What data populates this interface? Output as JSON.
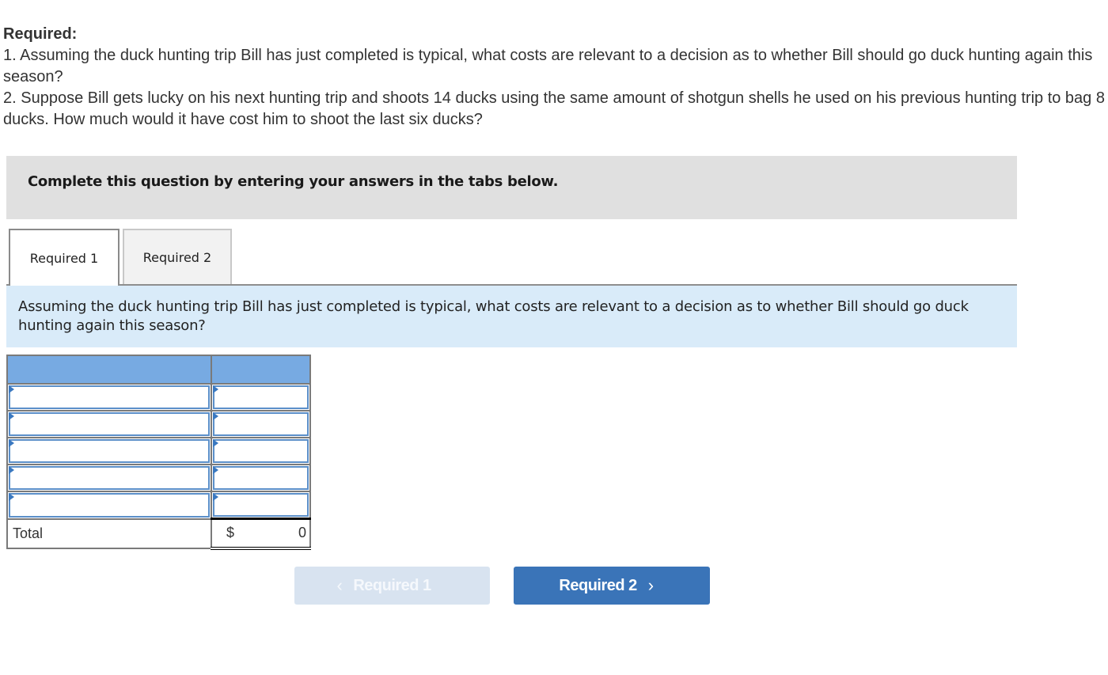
{
  "required": {
    "title": "Required:",
    "items": [
      "1.  Assuming the duck hunting trip Bill has just completed is typical, what costs are relevant to a decision as to whether Bill should go duck hunting again this season?",
      "2. Suppose Bill gets lucky on his next hunting trip and shoots 14 ducks using the same amount of shotgun shells he used on his previous hunting trip to bag 8 ducks. How much would it have cost him to shoot the last six ducks?"
    ]
  },
  "instruction": "Complete this question by entering your answers in the tabs below.",
  "tabs": [
    {
      "label": "Required 1",
      "active": true
    },
    {
      "label": "Required 2",
      "active": false
    }
  ],
  "question": "Assuming the duck hunting trip Bill has just completed is typical, what costs are relevant to a decision as to whether Bill should go duck hunting again this season?",
  "table": {
    "headers": [
      "",
      ""
    ],
    "rows": [
      {
        "item": "",
        "amount": ""
      },
      {
        "item": "",
        "amount": ""
      },
      {
        "item": "",
        "amount": ""
      },
      {
        "item": "",
        "amount": ""
      },
      {
        "item": "",
        "amount": ""
      }
    ],
    "total": {
      "label": "Total",
      "currency": "$",
      "value": "0"
    }
  },
  "nav": {
    "prev_label": "Required 1",
    "next_label": "Required 2",
    "prev_icon": "chevron-left-icon",
    "next_icon": "chevron-right-icon"
  }
}
